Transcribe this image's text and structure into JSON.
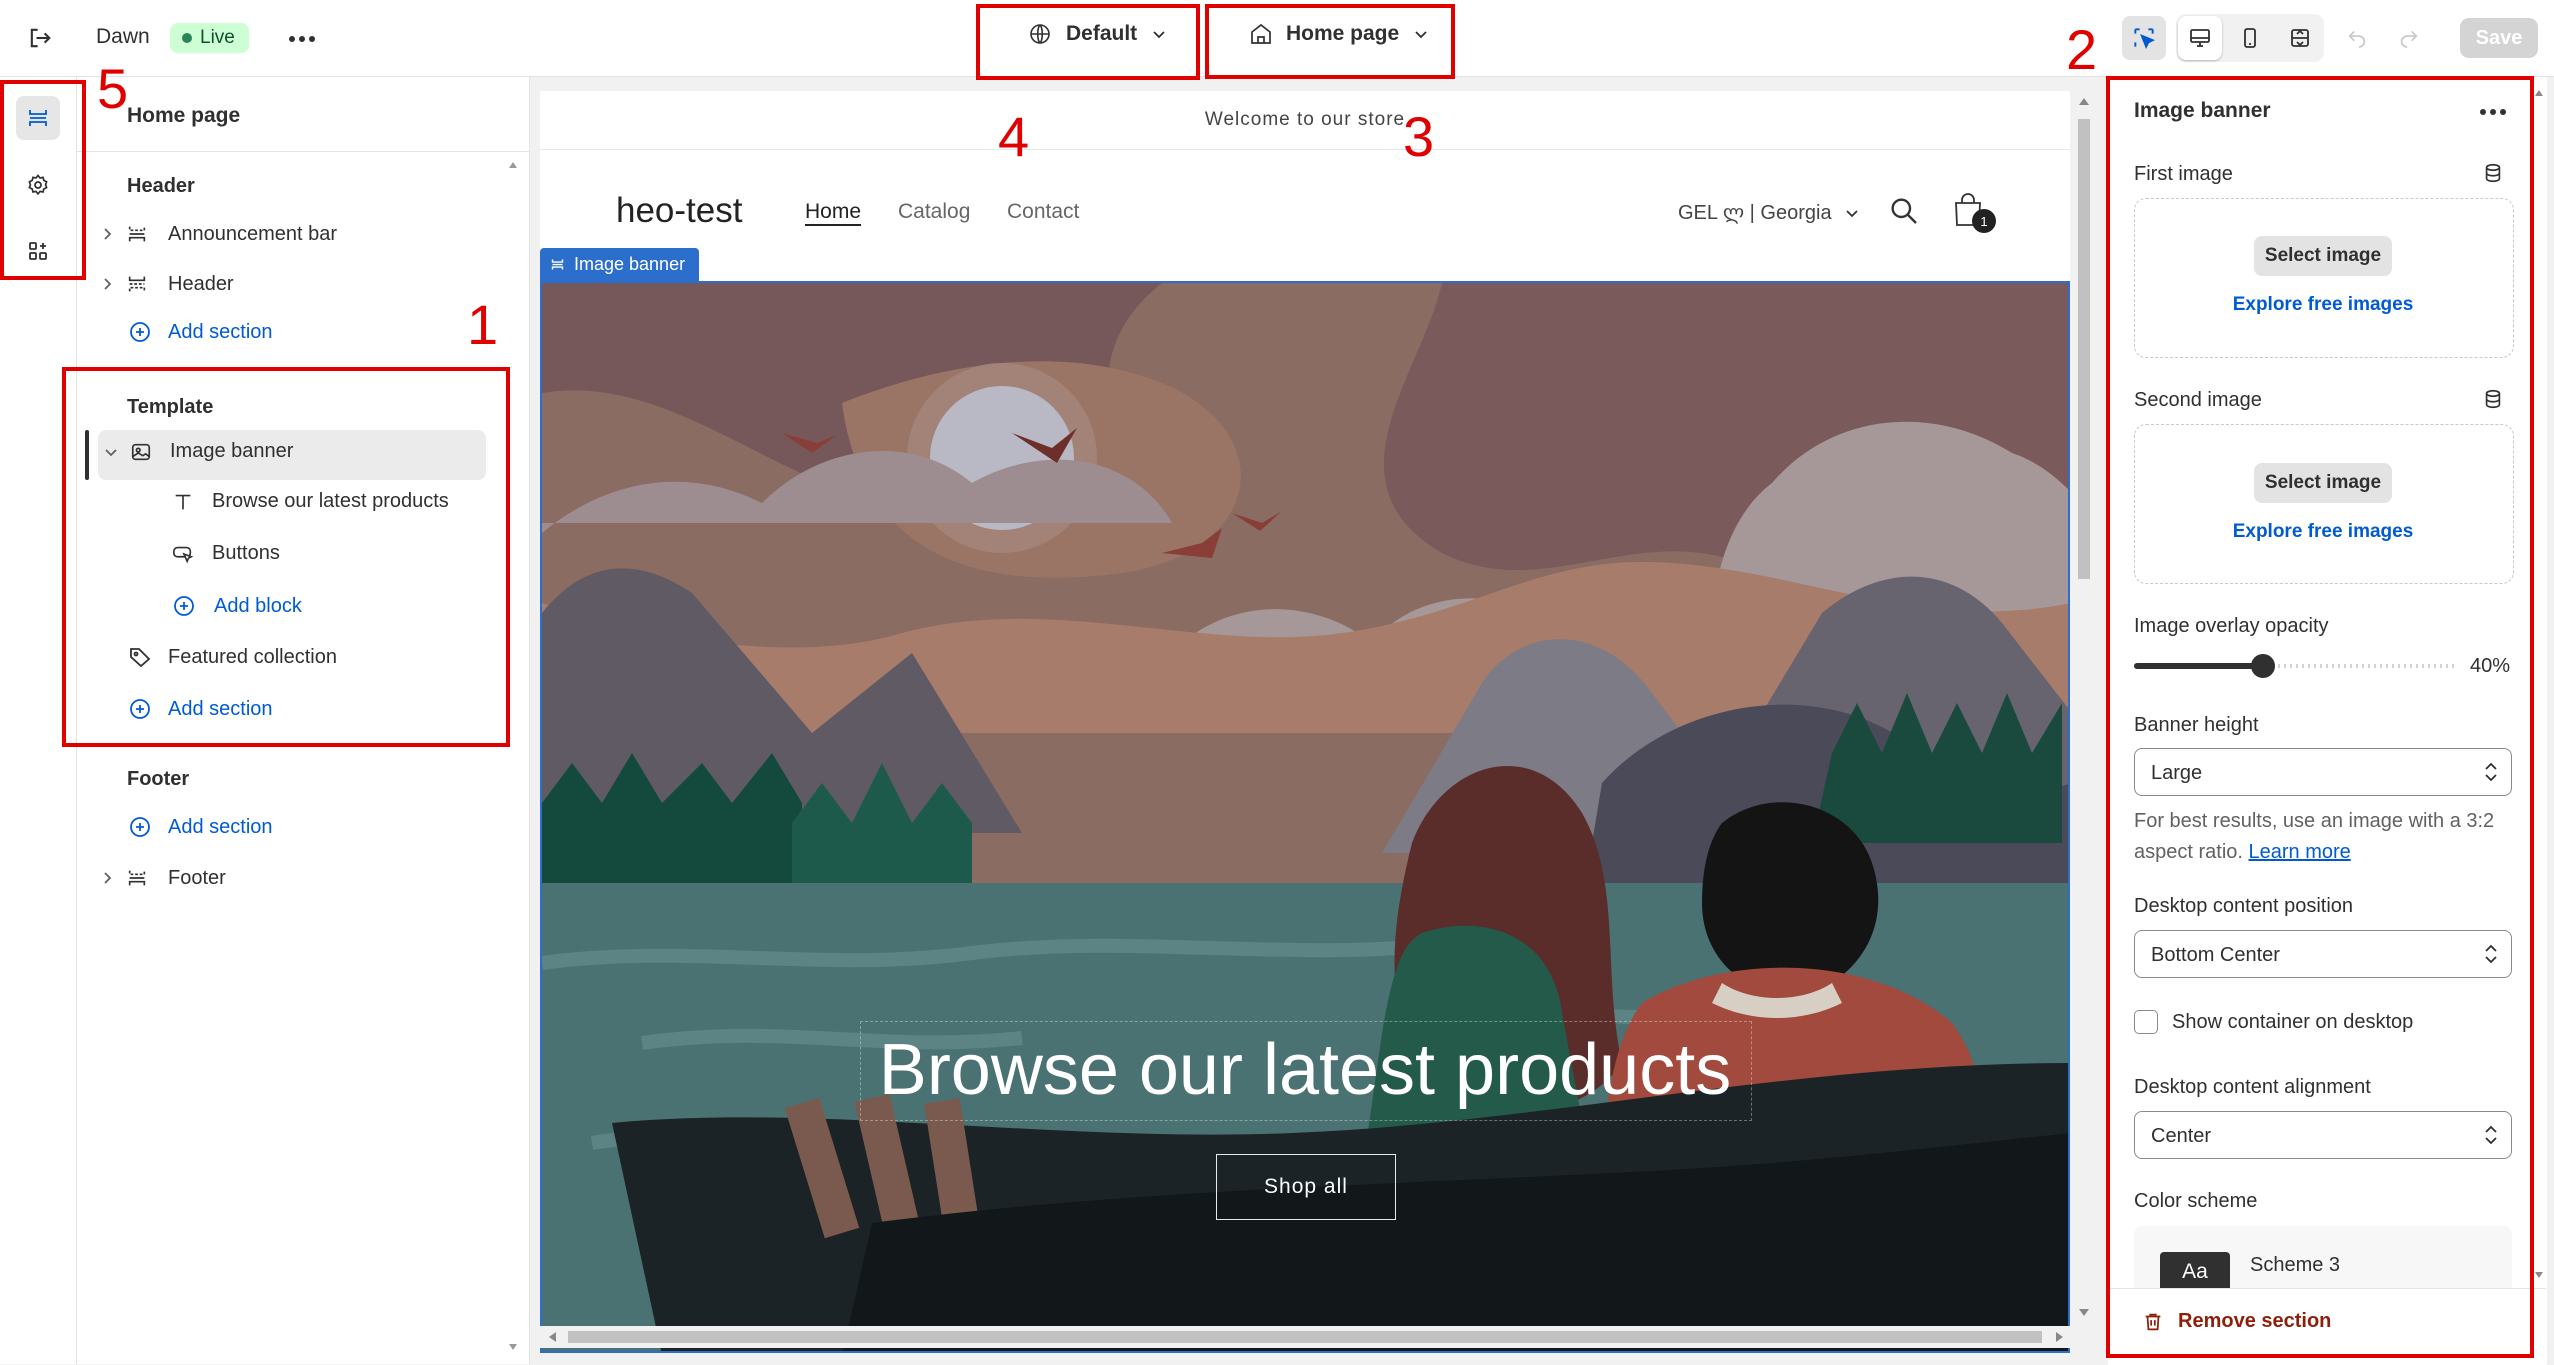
{
  "topbar": {
    "store_name": "Dawn",
    "live_badge": "Live",
    "theme_selector": "Default",
    "page_selector": "Home page",
    "save_label": "Save"
  },
  "left_panel": {
    "title": "Home page",
    "header_group": {
      "title": "Header",
      "items": [
        "Announcement bar",
        "Header"
      ],
      "add_section": "Add section"
    },
    "template_group": {
      "title": "Template",
      "section": "Image banner",
      "blocks": [
        "Browse our latest products",
        "Buttons"
      ],
      "add_block": "Add block",
      "featured": "Featured collection",
      "add_section": "Add section"
    },
    "footer_group": {
      "title": "Footer",
      "add_section": "Add section",
      "item": "Footer"
    }
  },
  "preview": {
    "announcement": "Welcome to our store",
    "logo": "heo-test",
    "nav": [
      "Home",
      "Catalog",
      "Contact"
    ],
    "currency": "GEL ლ | Georgia",
    "cart_count": "1",
    "section_tag": "Image banner",
    "headline": "Browse our latest products",
    "cta": "Shop all"
  },
  "right_panel": {
    "title": "Image banner",
    "first_image_label": "First image",
    "second_image_label": "Second image",
    "select_image": "Select image",
    "explore_images": "Explore free images",
    "overlay_label": "Image overlay opacity",
    "overlay_value_text": "40%",
    "overlay_value": 0.4,
    "banner_height_label": "Banner height",
    "banner_height_value": "Large",
    "help_text": "For best results, use an image with a 3:2 aspect ratio.",
    "learn_more": "Learn more",
    "desktop_position_label": "Desktop content position",
    "desktop_position_value": "Bottom Center",
    "show_container_label": "Show container on desktop",
    "desktop_alignment_label": "Desktop content alignment",
    "desktop_alignment_value": "Center",
    "color_scheme_label": "Color scheme",
    "color_scheme_swatch": "Aa",
    "color_scheme_value": "Scheme 3",
    "remove_section": "Remove section"
  },
  "annotations": [
    "1",
    "2",
    "3",
    "4",
    "5"
  ],
  "colors": {
    "accent": "#005bd3",
    "annotation": "#e00000",
    "danger": "#8e1f0b"
  }
}
